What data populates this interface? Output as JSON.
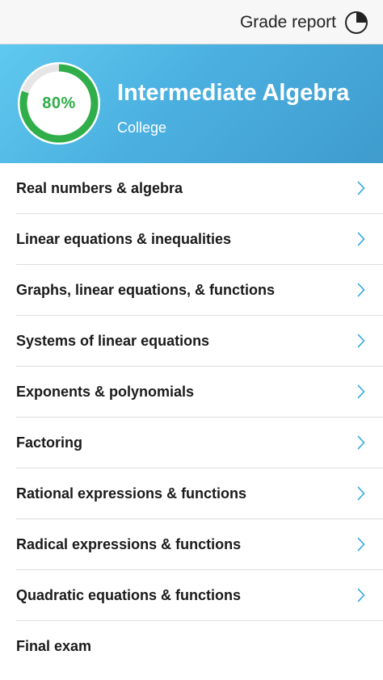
{
  "topbar": {
    "grade_report_label": "Grade report",
    "grade_report_icon": "pie-chart-icon"
  },
  "course": {
    "progress_text": "80%",
    "progress_fraction": 0.8,
    "title": "Intermediate Algebra",
    "level": "College",
    "colors": {
      "ring_fill": "#2fae49",
      "ring_track": "#e6e6e6",
      "header_gradient_start": "#5fc9ef",
      "header_gradient_end": "#3f9ccd"
    }
  },
  "chapters": [
    {
      "label": "Real numbers & algebra",
      "has_chevron": true
    },
    {
      "label": "Linear equations & inequalities",
      "has_chevron": true
    },
    {
      "label": "Graphs, linear equations, & functions",
      "has_chevron": true
    },
    {
      "label": "Systems of linear equations",
      "has_chevron": true
    },
    {
      "label": "Exponents & polynomials",
      "has_chevron": true
    },
    {
      "label": "Factoring",
      "has_chevron": true
    },
    {
      "label": "Rational expressions & functions",
      "has_chevron": true
    },
    {
      "label": "Radical expressions & functions",
      "has_chevron": true
    },
    {
      "label": "Quadratic equations & functions",
      "has_chevron": true
    },
    {
      "label": "Final exam",
      "has_chevron": false
    }
  ],
  "accent_color": "#2aa6e0",
  "chevron_icon": "chevron-right-icon"
}
